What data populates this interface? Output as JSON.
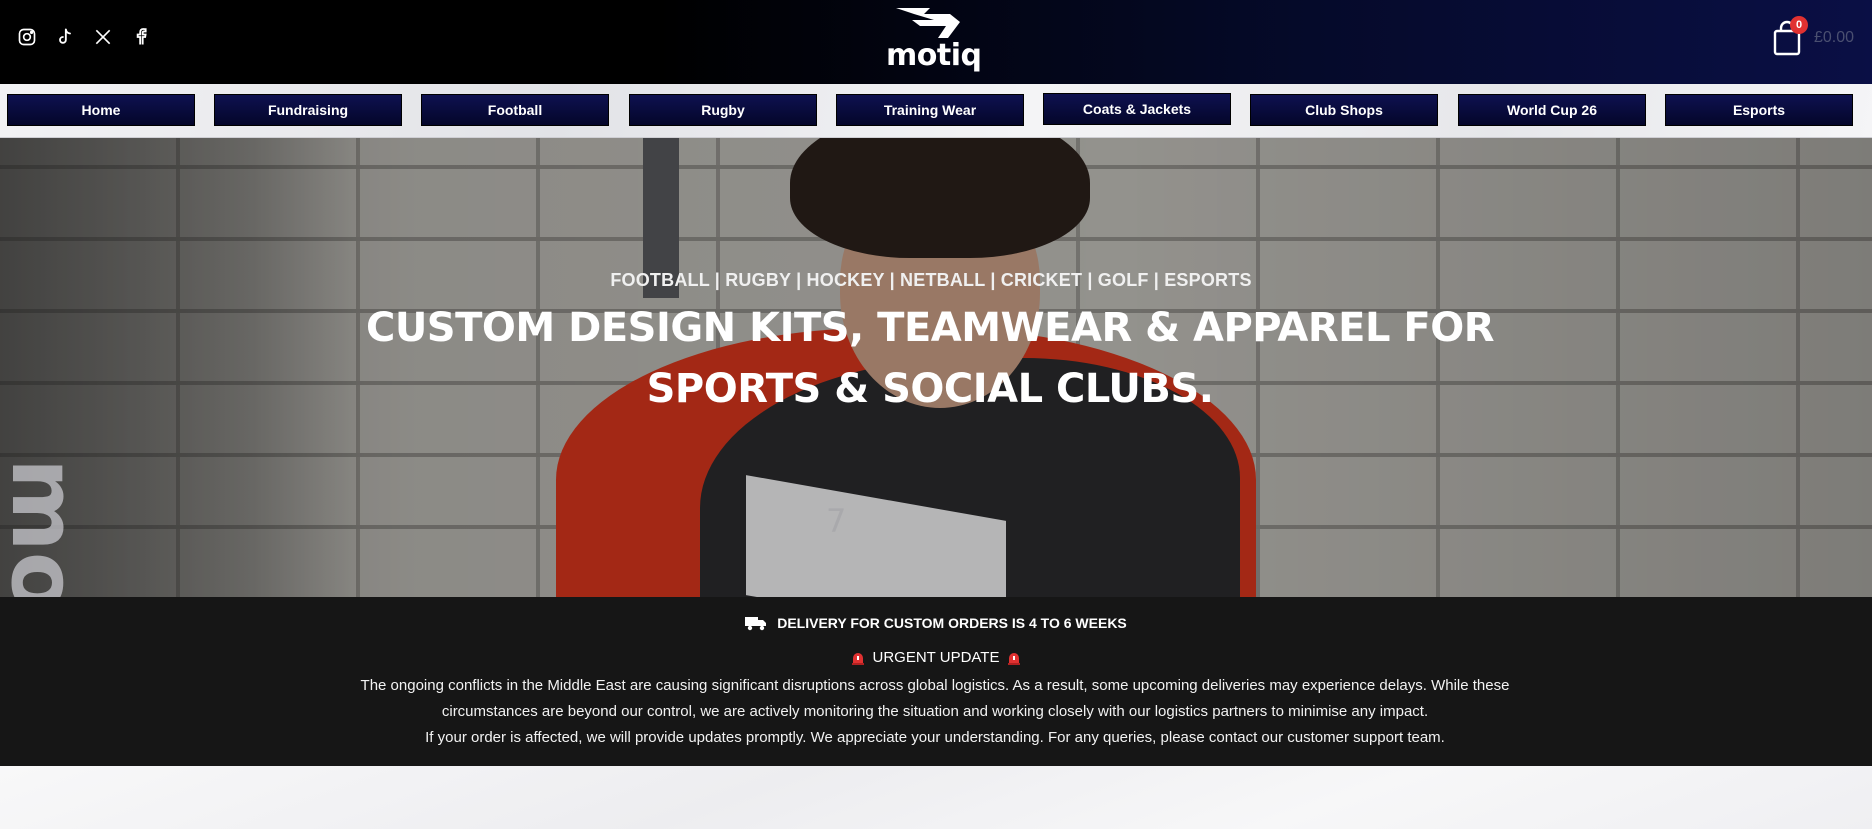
{
  "header": {
    "logo_text": "motiq",
    "cart_count": "0",
    "cart_total": "£0.00",
    "social_icons": [
      "instagram-icon",
      "tiktok-icon",
      "x-icon",
      "facebook-icon"
    ]
  },
  "nav": {
    "items": [
      {
        "label": "Home"
      },
      {
        "label": "Fundraising"
      },
      {
        "label": "Football"
      },
      {
        "label": "Rugby"
      },
      {
        "label": "Training Wear"
      },
      {
        "label": "Coats & Jackets"
      },
      {
        "label": "Club Shops"
      },
      {
        "label": "World Cup 26"
      },
      {
        "label": "Esports"
      }
    ]
  },
  "hero": {
    "subtitle": "FOOTBALL | RUGBY | HOCKEY | NETBALL | CRICKET | GOLF | ESPORTS",
    "title": "CUSTOM DESIGN KITS, TEAMWEAR & APPAREL FOR SPORTS & SOCIAL CLUBS.",
    "side_wordmark": "motiq",
    "chest_number": "7"
  },
  "notice": {
    "delivery": "DELIVERY FOR CUSTOM ORDERS IS 4 TO 6 WEEKS",
    "urgent": "URGENT UPDATE",
    "body_1": "The ongoing conflicts in the Middle East are causing significant disruptions across global logistics. As a result, some upcoming deliveries may experience delays. While these circumstances are beyond our control, we are actively monitoring the situation and working closely with our logistics partners to minimise any impact.",
    "body_2": "If your order is affected, we will provide updates promptly. We appreciate your understanding. For any queries, please contact our customer support team."
  },
  "colors": {
    "nav_button": "#04062a",
    "badge": "#e03131",
    "notice_bg": "#161616"
  }
}
